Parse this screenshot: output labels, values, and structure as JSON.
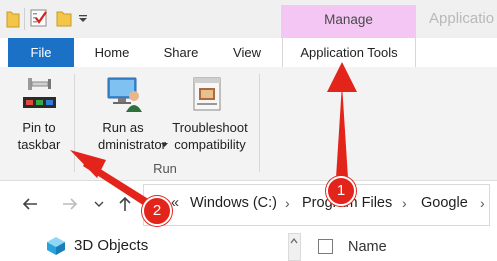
{
  "titlebar": {
    "contextual_group": "Manage",
    "window_title": "Applicatio"
  },
  "tabs": {
    "file": "File",
    "home": "Home",
    "share": "Share",
    "view": "View",
    "application_tools": "Application Tools"
  },
  "ribbon": {
    "pin_to_taskbar": {
      "line1": "Pin to",
      "line2": "taskbar"
    },
    "run_as_admin": {
      "line1": "Run as",
      "line2": "dministrator"
    },
    "troubleshoot": {
      "line1": "Troubleshoot",
      "line2": "compatibility"
    },
    "group_run": "Run"
  },
  "address": {
    "ellipsis": "«",
    "crumbs": [
      "Windows (C:)",
      "Program Files",
      "Google"
    ]
  },
  "sidebar": {
    "item_3d_objects": "3D Objects"
  },
  "columns": {
    "name": "Name"
  },
  "annotations": {
    "badge1": "1",
    "badge2": "2"
  },
  "colors": {
    "file_tab": "#1b71c5",
    "manage_band": "#f4c6f4",
    "annotation": "#e3241b",
    "folder": "#f3c64b"
  }
}
